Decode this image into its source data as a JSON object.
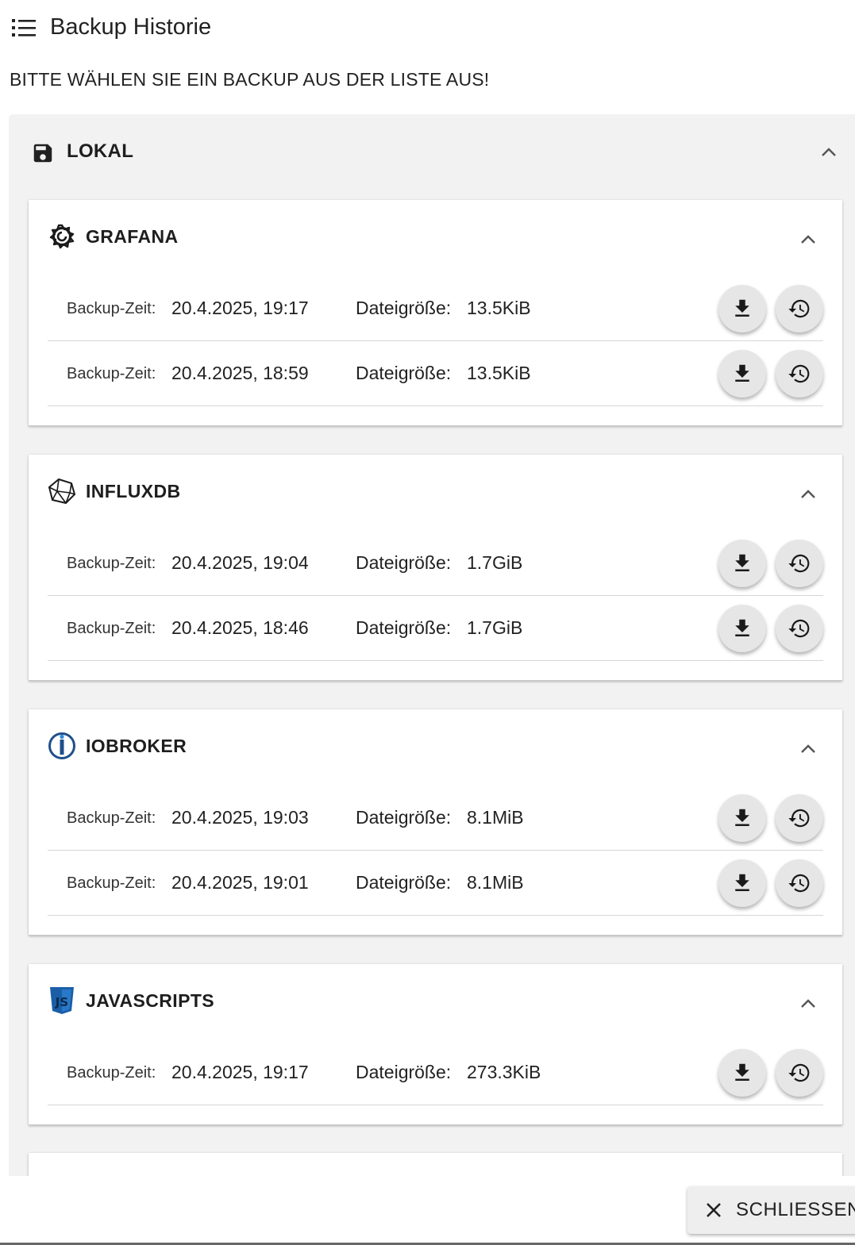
{
  "header": {
    "title": "Backup Historie",
    "icon": "list-icon"
  },
  "instruction": "BITTE WÄHLEN SIE EIN BACKUP AUS DER LISTE AUS!",
  "section": {
    "label": "LOKAL",
    "icon": "floppy-disk-icon"
  },
  "labels": {
    "time": "Backup-Zeit:",
    "size": "Dateigröße:"
  },
  "groups": [
    {
      "name": "GRAFANA",
      "icon": "grafana-icon",
      "backups": [
        {
          "time": "20.4.2025, 19:17",
          "size": "13.5KiB"
        },
        {
          "time": "20.4.2025, 18:59",
          "size": "13.5KiB"
        }
      ]
    },
    {
      "name": "INFLUXDB",
      "icon": "influxdb-icon",
      "backups": [
        {
          "time": "20.4.2025, 19:04",
          "size": "1.7GiB"
        },
        {
          "time": "20.4.2025, 18:46",
          "size": "1.7GiB"
        }
      ]
    },
    {
      "name": "IOBROKER",
      "icon": "iobroker-icon",
      "backups": [
        {
          "time": "20.4.2025, 19:03",
          "size": "8.1MiB"
        },
        {
          "time": "20.4.2025, 19:01",
          "size": "8.1MiB"
        }
      ]
    },
    {
      "name": "JAVASCRIPTS",
      "icon": "javascript-icon",
      "backups": [
        {
          "time": "20.4.2025, 19:17",
          "size": "273.3KiB"
        }
      ]
    }
  ],
  "footer": {
    "close_label": "SCHLIESSEN"
  },
  "colors": {
    "panel": "#f2f2f2",
    "fab": "#e6e6e6",
    "iobroker_blue": "#1f4f8a",
    "js_blue": "#1a5ea8"
  }
}
